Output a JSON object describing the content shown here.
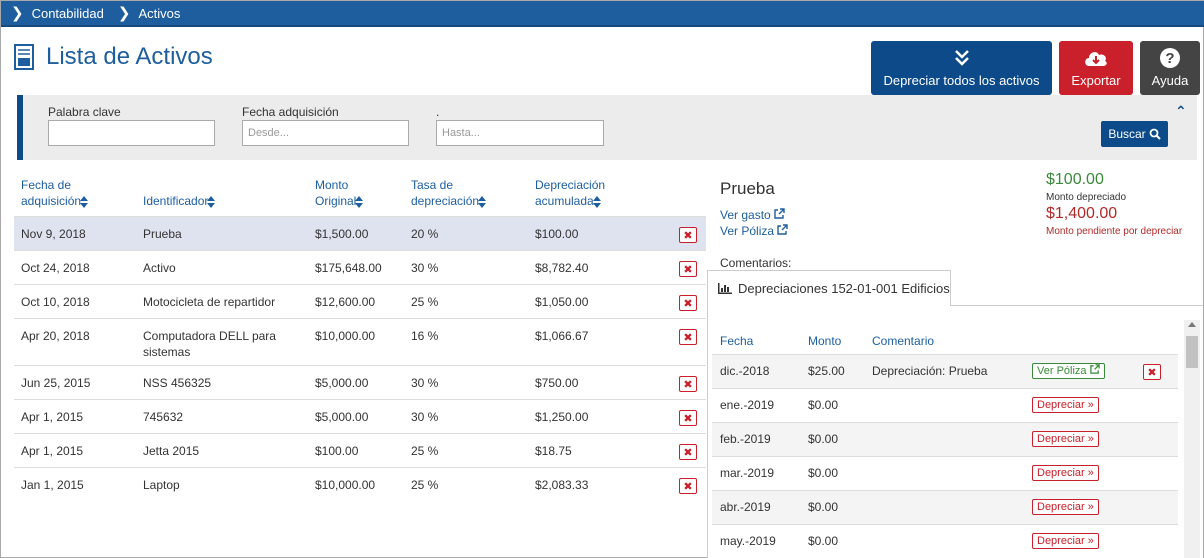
{
  "breadcrumb": [
    "Contabilidad",
    "Activos"
  ],
  "page_title": "Lista de Activos",
  "actions": {
    "depreciate_all": "Depreciar todos los activos",
    "export": "Exportar",
    "help": "Ayuda"
  },
  "filters": {
    "keyword_label": "Palabra clave",
    "keyword_value": "",
    "date_label": "Fecha adquisición",
    "from_placeholder": "Desde...",
    "to_label": ".",
    "to_placeholder": "Hasta...",
    "search_label": "Buscar"
  },
  "table": {
    "headers": {
      "fecha1": "Fecha de",
      "fecha2": "adquisición",
      "ident": "Identificador",
      "monto1": "Monto",
      "monto2": "Original",
      "tasa1": "Tasa de",
      "tasa2": "depreciación",
      "dep1": "Depreciación",
      "dep2": "acumulada"
    },
    "rows": [
      {
        "fecha": "Nov 9, 2018",
        "id": "Prueba",
        "id2": "",
        "monto": "$1,500.00",
        "tasa": "20 %",
        "dep": "$100.00"
      },
      {
        "fecha": "Oct 24, 2018",
        "id": "Activo",
        "id2": "",
        "monto": "$175,648.00",
        "tasa": "30 %",
        "dep": "$8,782.40"
      },
      {
        "fecha": "Oct 10, 2018",
        "id": "Motocicleta de repartidor",
        "id2": "",
        "monto": "$12,600.00",
        "tasa": "25 %",
        "dep": "$1,050.00"
      },
      {
        "fecha": "Apr 20, 2018",
        "id": "Computadora DELL para",
        "id2": "sistemas",
        "monto": "$10,000.00",
        "tasa": "16 %",
        "dep": "$1,066.67"
      },
      {
        "fecha": "Jun 25, 2015",
        "id": "NSS 456325",
        "id2": "",
        "monto": "$5,000.00",
        "tasa": "30 %",
        "dep": "$750.00"
      },
      {
        "fecha": "Apr 1, 2015",
        "id": "745632",
        "id2": "",
        "monto": "$5,000.00",
        "tasa": "30 %",
        "dep": "$1,250.00"
      },
      {
        "fecha": "Apr 1, 2015",
        "id": "Jetta 2015",
        "id2": "",
        "monto": "$100.00",
        "tasa": "25 %",
        "dep": "$18.75"
      },
      {
        "fecha": "Jan 1, 2015",
        "id": "Laptop",
        "id2": "",
        "monto": "$10,000.00",
        "tasa": "25 %",
        "dep": "$2,083.33"
      }
    ],
    "delete_glyph": "✖"
  },
  "detail": {
    "name": "Prueba",
    "ver_gasto": "Ver gasto",
    "ver_poliza": "Ver Póliza",
    "depreciated_amount": "$100.00",
    "depreciated_label": "Monto depreciado",
    "pending_amount": "$1,400.00",
    "pending_label": "Monto pendiente por depreciar",
    "comments_label": "Comentarios:",
    "tab_label": "Depreciaciones 152-01-001 Edificios",
    "dep_headers": {
      "fecha": "Fecha",
      "monto": "Monto",
      "comentario": "Comentario"
    },
    "dep_rows": [
      {
        "fecha": "dic.-2018",
        "monto": "$25.00",
        "comentario": "Depreciación: Prueba",
        "action": "Ver Póliza"
      },
      {
        "fecha": "ene.-2019",
        "monto": "$0.00",
        "comentario": "",
        "action": "Depreciar"
      },
      {
        "fecha": "feb.-2019",
        "monto": "$0.00",
        "comentario": "",
        "action": "Depreciar"
      },
      {
        "fecha": "mar.-2019",
        "monto": "$0.00",
        "comentario": "",
        "action": "Depreciar"
      },
      {
        "fecha": "abr.-2019",
        "monto": "$0.00",
        "comentario": "",
        "action": "Depreciar"
      },
      {
        "fecha": "may.-2019",
        "monto": "$0.00",
        "comentario": "",
        "action": "Depreciar"
      }
    ]
  },
  "colors": {
    "primary": "#1e5e9e",
    "navy": "#0c4a8a",
    "danger": "#c9202b",
    "success": "#3a8a3a",
    "dark": "#444444"
  }
}
